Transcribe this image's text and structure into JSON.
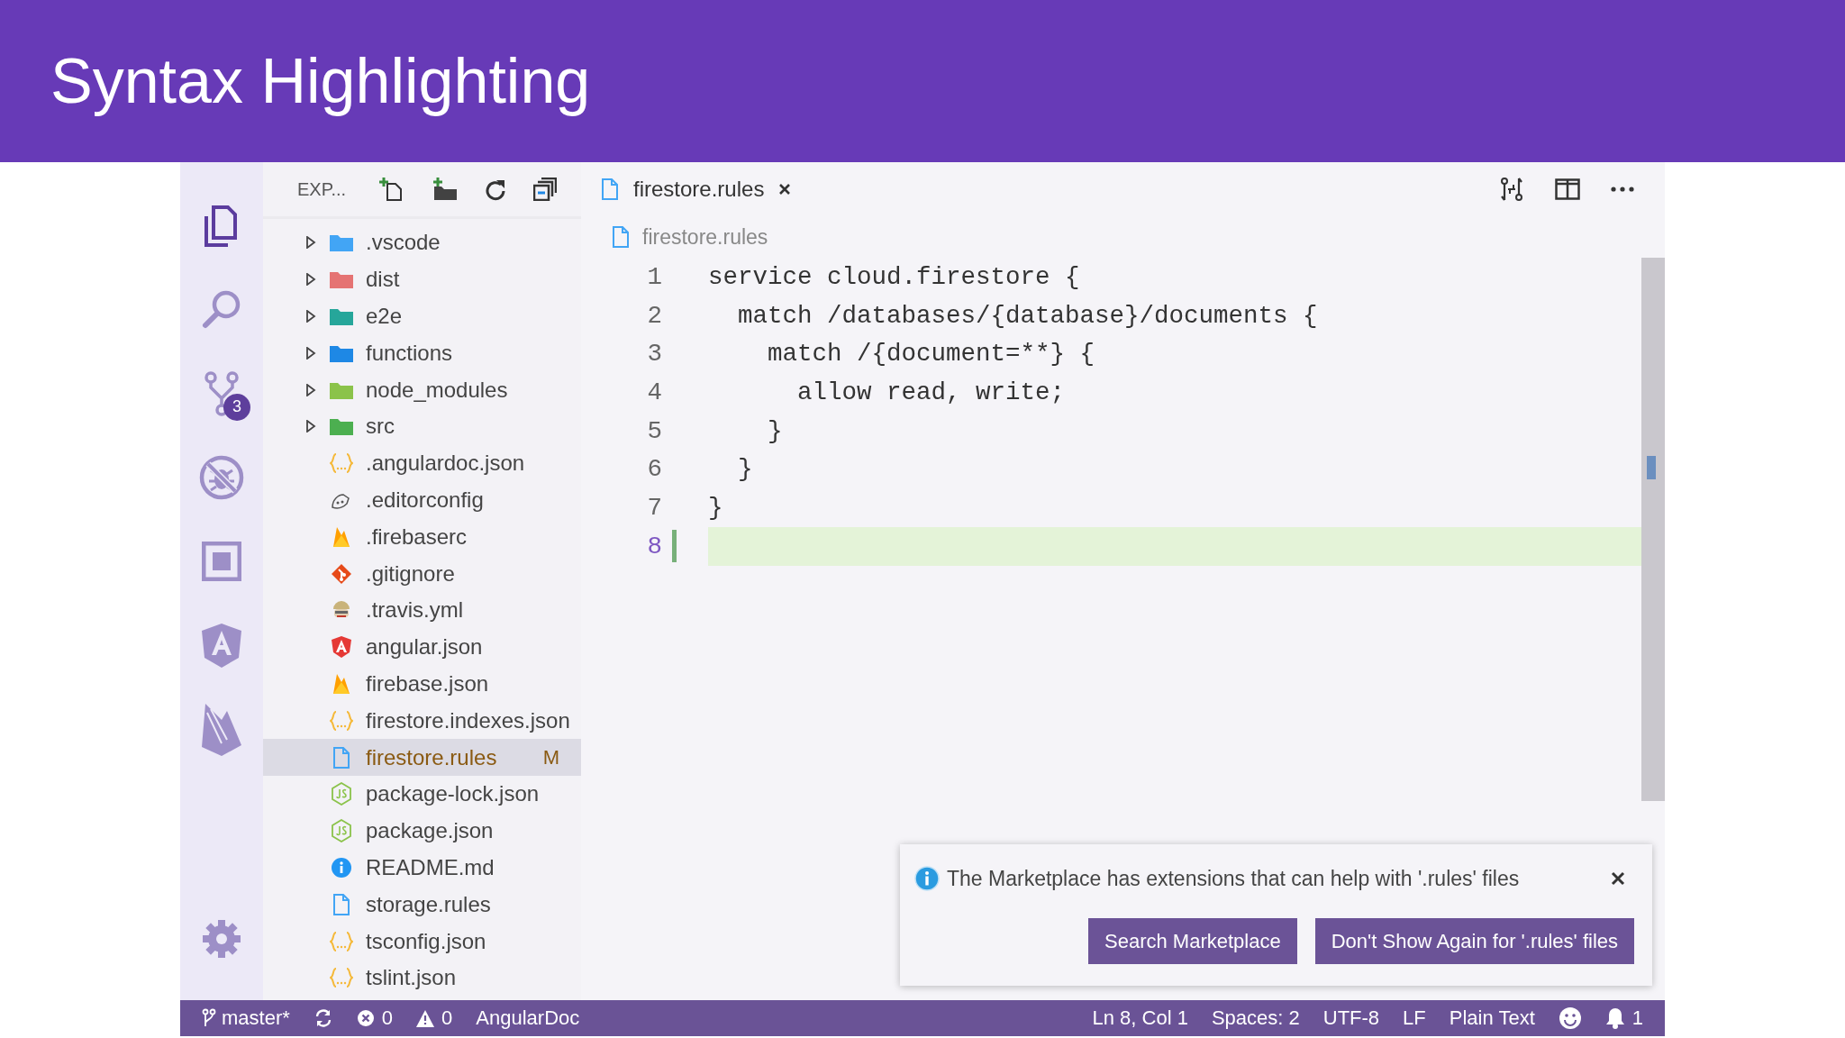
{
  "slide": {
    "title": "Syntax Highlighting"
  },
  "activity_bar": {
    "items": [
      {
        "kind": "explorer",
        "selected": true
      },
      {
        "kind": "search",
        "selected": false
      },
      {
        "kind": "source-control",
        "selected": false,
        "badge": "3"
      },
      {
        "kind": "debug",
        "selected": false
      },
      {
        "kind": "extensions",
        "selected": false
      },
      {
        "kind": "angular",
        "selected": false
      },
      {
        "kind": "firebase",
        "selected": false
      },
      {
        "kind": "settings",
        "selected": false
      }
    ]
  },
  "sidebar": {
    "title": "EXP...",
    "files": [
      {
        "name": ".vscode",
        "kind": "folder",
        "color": "#42a5f5",
        "expanded": false,
        "selected": false
      },
      {
        "name": "dist",
        "kind": "folder",
        "color": "#e57373",
        "expanded": false,
        "selected": false
      },
      {
        "name": "e2e",
        "kind": "folder",
        "color": "#26a69a",
        "expanded": false,
        "selected": false
      },
      {
        "name": "functions",
        "kind": "folder",
        "color": "#1e88e5",
        "expanded": false,
        "selected": false
      },
      {
        "name": "node_modules",
        "kind": "folder",
        "color": "#8bc34a",
        "expanded": false,
        "selected": false
      },
      {
        "name": "src",
        "kind": "folder",
        "color": "#4caf50",
        "expanded": false,
        "selected": false
      },
      {
        "name": ".angulardoc.json",
        "kind": "json",
        "selected": false
      },
      {
        "name": ".editorconfig",
        "kind": "editorconfig",
        "selected": false
      },
      {
        "name": ".firebaserc",
        "kind": "firebase",
        "selected": false
      },
      {
        "name": ".gitignore",
        "kind": "git",
        "selected": false
      },
      {
        "name": ".travis.yml",
        "kind": "travis",
        "selected": false
      },
      {
        "name": "angular.json",
        "kind": "angular",
        "selected": false
      },
      {
        "name": "firebase.json",
        "kind": "firebase",
        "selected": false
      },
      {
        "name": "firestore.indexes.json",
        "kind": "json",
        "selected": false
      },
      {
        "name": "firestore.rules",
        "kind": "document",
        "selected": true,
        "git_status": "M"
      },
      {
        "name": "package-lock.json",
        "kind": "npm",
        "selected": false
      },
      {
        "name": "package.json",
        "kind": "npm",
        "selected": false
      },
      {
        "name": "README.md",
        "kind": "info",
        "selected": false
      },
      {
        "name": "storage.rules",
        "kind": "document",
        "selected": false
      },
      {
        "name": "tsconfig.json",
        "kind": "json",
        "selected": false
      },
      {
        "name": "tslint.json",
        "kind": "json",
        "selected": false
      }
    ]
  },
  "editor": {
    "tab": {
      "name": "firestore.rules",
      "selected": true
    },
    "breadcrumb": "firestore.rules",
    "lines": [
      {
        "number": "1",
        "text": "service cloud.firestore {",
        "current": false,
        "added": false
      },
      {
        "number": "2",
        "text": "  match /databases/{database}/documents {",
        "current": false,
        "added": false
      },
      {
        "number": "3",
        "text": "    match /{document=**} {",
        "current": false,
        "added": false
      },
      {
        "number": "4",
        "text": "      allow read, write;",
        "current": false,
        "added": false
      },
      {
        "number": "5",
        "text": "    }",
        "current": false,
        "added": false
      },
      {
        "number": "6",
        "text": "  }",
        "current": false,
        "added": false
      },
      {
        "number": "7",
        "text": "}",
        "current": false,
        "added": false
      },
      {
        "number": "8",
        "current": true,
        "added": true
      }
    ]
  },
  "notification": {
    "message": "The Marketplace has extensions that can help with '.rules' files",
    "buttons": [
      "Search Marketplace",
      "Don't Show Again for '.rules' files"
    ]
  },
  "status_bar": {
    "left": [
      {
        "kind": "branch",
        "text": "master*"
      },
      {
        "kind": "sync"
      },
      {
        "kind": "errors",
        "text": "0"
      },
      {
        "kind": "warnings",
        "text": "0"
      },
      {
        "kind": "text",
        "text": "AngularDoc"
      }
    ],
    "right": [
      {
        "kind": "text",
        "text": "Ln 8, Col 1"
      },
      {
        "kind": "text",
        "text": "Spaces: 2"
      },
      {
        "kind": "text",
        "text": "UTF-8"
      },
      {
        "kind": "text",
        "text": "LF"
      },
      {
        "kind": "text",
        "text": "Plain Text"
      },
      {
        "kind": "feedback"
      },
      {
        "kind": "notifications",
        "text": "1"
      }
    ]
  }
}
